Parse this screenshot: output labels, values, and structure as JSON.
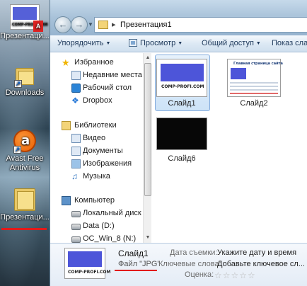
{
  "desktop": {
    "icons": [
      {
        "label": "Презентаци..."
      },
      {
        "label": "Downloads"
      },
      {
        "label": "Avast Free"
      },
      {
        "label": "Antivirus"
      },
      {
        "label": "Презентаци..."
      }
    ],
    "thumb_caption": "COMP-PROFI.COM"
  },
  "window": {
    "address": {
      "path": "Презентация1",
      "separator": "▸"
    },
    "toolbar": {
      "organize": "Упорядочить",
      "preview": "Просмотр",
      "share": "Общий доступ",
      "slideshow": "Показ слайд"
    },
    "nav": {
      "favorites": "Избранное",
      "recent": "Недавние места",
      "desktop": "Рабочий стол",
      "dropbox": "Dropbox",
      "libraries": "Библиотеки",
      "video": "Видео",
      "documents": "Документы",
      "images": "Изображения",
      "music": "Музыка",
      "computer": "Компьютер",
      "local_disk": "Локальный диск (C",
      "data_d": "Data (D:)",
      "win8": "OC_Win_8 (N:)"
    },
    "files": [
      {
        "name": "Слайд1",
        "caption": "COMP-PROFI.COM"
      },
      {
        "name": "Слайд2",
        "caption": "Главная страница сайта"
      },
      {
        "name": "Слайд6"
      }
    ],
    "details": {
      "name": "Слайд1",
      "type": "Файл \"JPG\"",
      "date_label": "Дата съемки:",
      "date_value": "Укажите дату и время",
      "keywords_label": "Ключевые слова:",
      "keywords_value": "Добавьте ключевое сл...",
      "rating_label": "Оценка:",
      "rating_stars": "☆☆☆☆☆",
      "rating": 0,
      "thumb_caption": "COMP-PROFI.COM"
    }
  },
  "colors": {
    "accent_red": "#e21b1b",
    "slide_blue": "#4d55d9",
    "selection": "#cde3f7"
  }
}
